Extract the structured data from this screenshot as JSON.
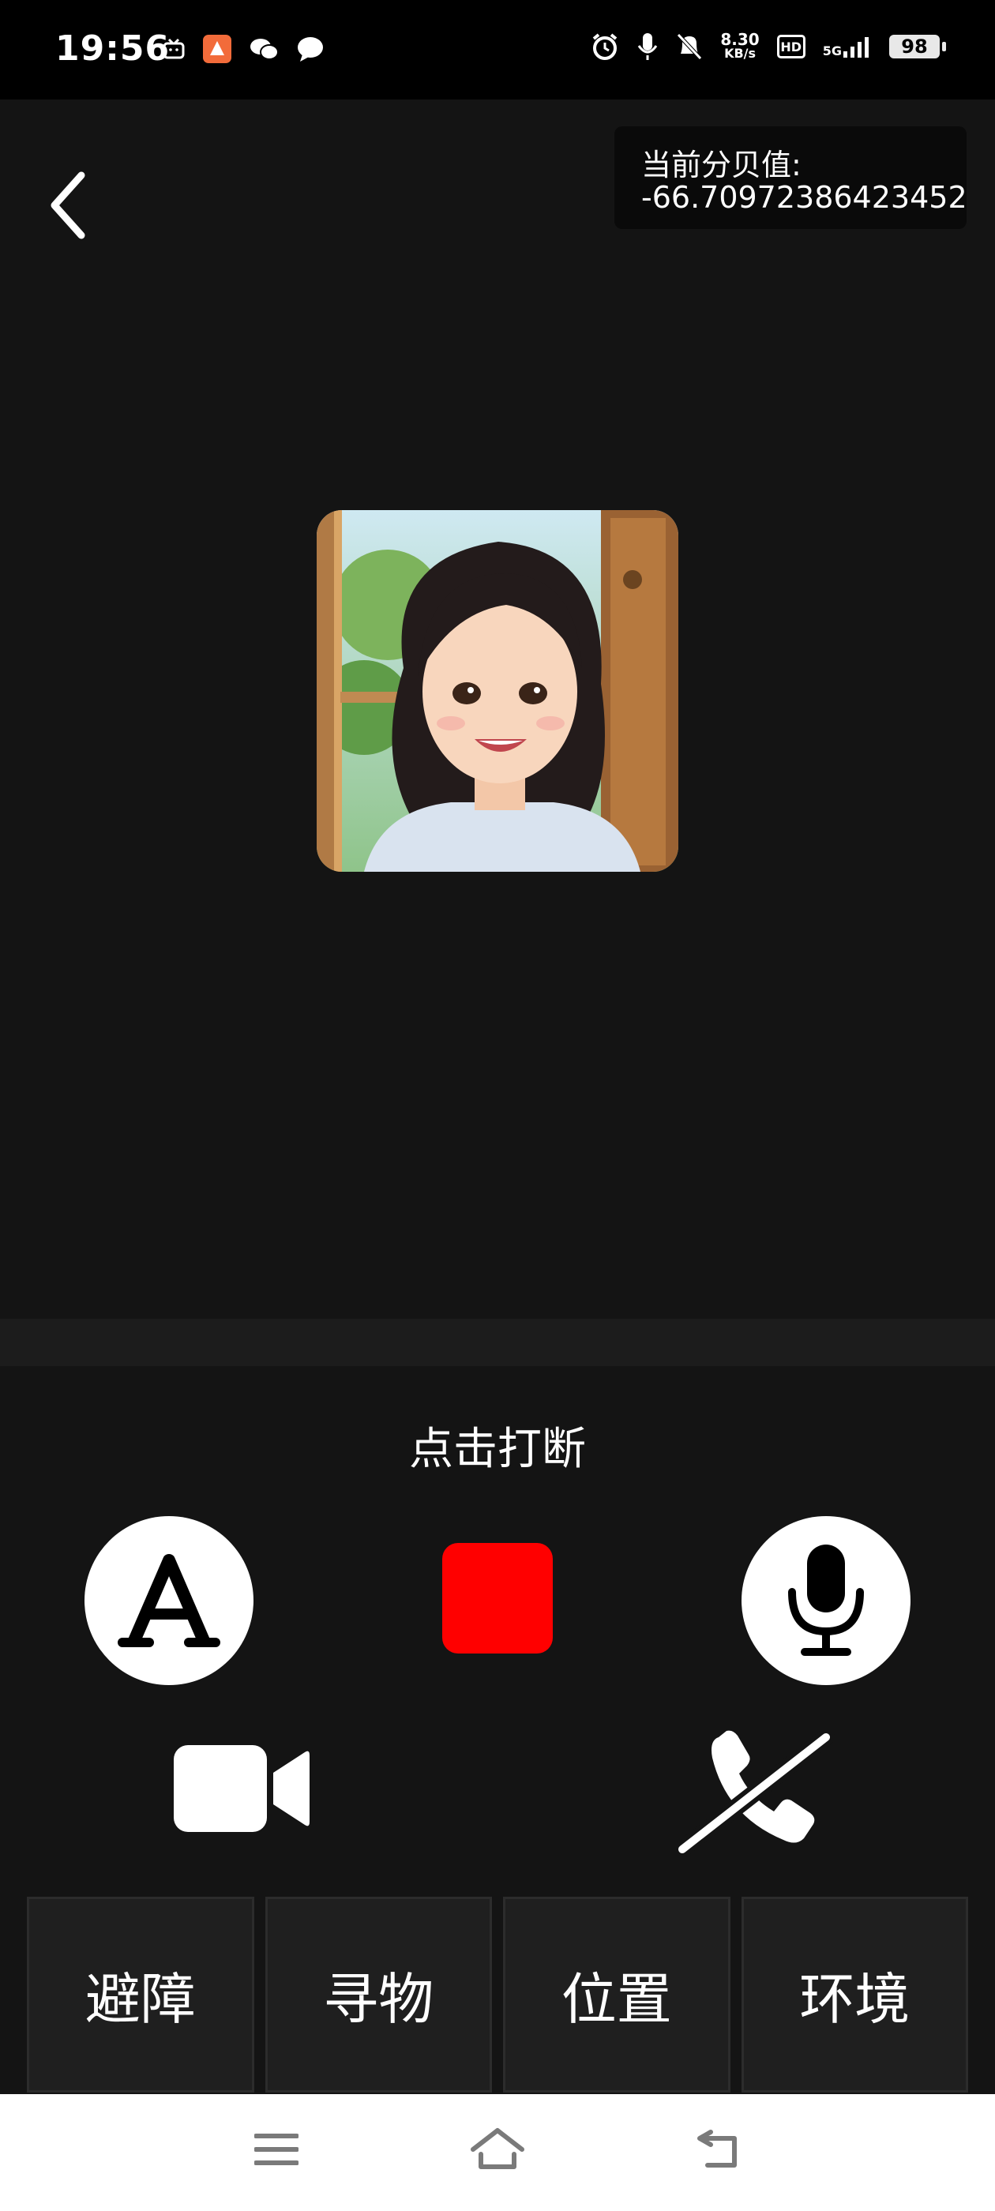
{
  "status_bar": {
    "time": "19:56",
    "net_speed_value": "8.30",
    "net_speed_unit": "KB/s",
    "hd_label": "HD",
    "network_label": "5G",
    "battery_level": "98"
  },
  "header": {
    "decibel_label": "当前分贝值:",
    "decibel_value": "-66.70972386423452"
  },
  "controls": {
    "interrupt_label": "点击打断"
  },
  "tabs": [
    {
      "label": "避障"
    },
    {
      "label": "寻物"
    },
    {
      "label": "位置"
    },
    {
      "label": "环境"
    }
  ],
  "colors": {
    "background": "#141414",
    "stop_button": "#ff0000",
    "button_white": "#ffffff"
  },
  "icons": {
    "back": "chevron-left-icon",
    "text_mode": "letter-a-icon",
    "mic": "microphone-icon",
    "video": "video-camera-icon",
    "hangup": "phone-off-icon"
  }
}
